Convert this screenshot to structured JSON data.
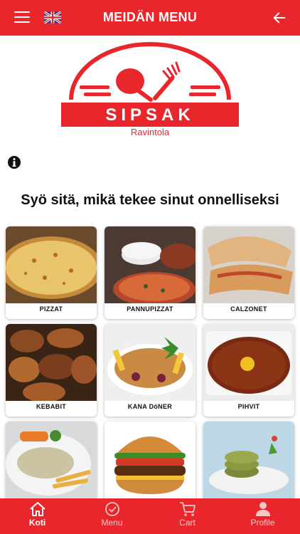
{
  "header": {
    "title": "MEIDÄN MENU",
    "menu_icon": "hamburger-icon",
    "language_icon": "uk-flag-icon",
    "back_icon": "arrow-left-icon"
  },
  "brand": {
    "name": "SIPSAK",
    "subtitle": "Ravintola",
    "accent": "#e8262b"
  },
  "tagline": "Syö sitä, mikä tekee sinut onnelliseksi",
  "categories": [
    {
      "label": "PIZZAT"
    },
    {
      "label": "PANNUPIZZAT"
    },
    {
      "label": "CALZONET"
    },
    {
      "label": "KEBABIT"
    },
    {
      "label": "KANA DöNER"
    },
    {
      "label": "PIHVIT"
    },
    {
      "label": ""
    },
    {
      "label": ""
    },
    {
      "label": ""
    }
  ],
  "bottom_nav": [
    {
      "label": "Koti",
      "icon": "home-icon",
      "active": true
    },
    {
      "label": "Menu",
      "icon": "check-circle-icon",
      "active": false
    },
    {
      "label": "Cart",
      "icon": "cart-icon",
      "active": false
    },
    {
      "label": "Profile",
      "icon": "person-icon",
      "active": false
    }
  ]
}
